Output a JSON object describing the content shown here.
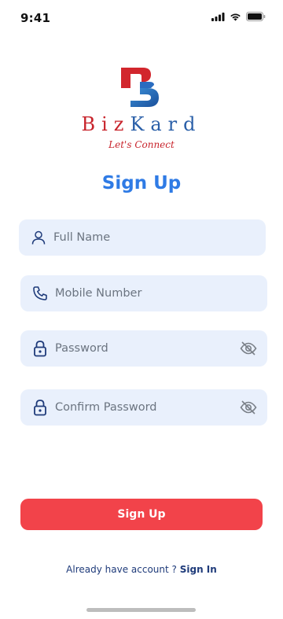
{
  "status_bar": {
    "time": "9:41",
    "icons": [
      "signal-icon",
      "wifi-icon",
      "battery-icon"
    ]
  },
  "brand": {
    "name_part1": "Biz",
    "name_part2": "Kard",
    "tagline": "Let's Connect",
    "colors": {
      "red": "#c8242c",
      "blue": "#2a5fa8"
    }
  },
  "page": {
    "title": "Sign Up",
    "title_color": "#2f7be5"
  },
  "form": {
    "full_name": {
      "placeholder": "Full Name",
      "value": "",
      "icon": "user-icon"
    },
    "mobile": {
      "placeholder": "Mobile Number",
      "value": "",
      "icon": "phone-icon"
    },
    "password": {
      "placeholder": "Password",
      "value": "",
      "icon": "lock-icon",
      "toggle_icon": "eye-off-icon"
    },
    "confirm_password": {
      "placeholder": "Confirm Password",
      "value": "",
      "icon": "lock-icon",
      "toggle_icon": "eye-off-icon"
    },
    "field_bg": "#e9f0fc"
  },
  "actions": {
    "signup_label": "Sign Up",
    "signup_color": "#f2434a",
    "signin_prompt": "Already have account ?",
    "signin_link": "Sign In"
  }
}
